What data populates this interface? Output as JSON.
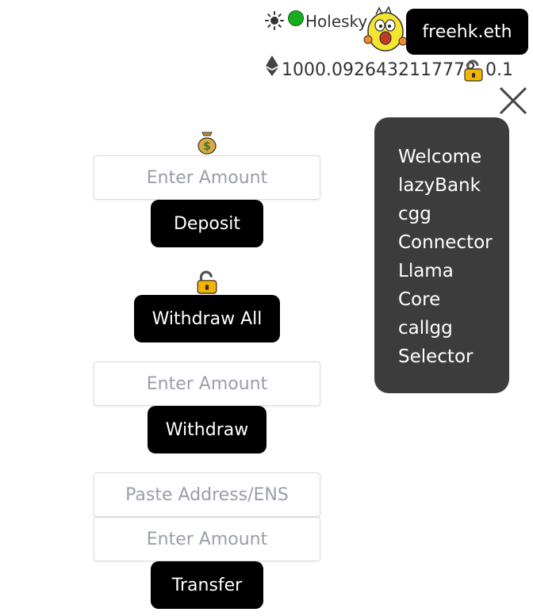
{
  "header": {
    "network_label": "Holesky",
    "account_label": "freehk.eth",
    "eth_balance": "1000.0926432117778",
    "locked_balance": "0.1"
  },
  "menu": {
    "items": [
      "Welcome",
      "lazyBank",
      "cgg",
      "Connector",
      "Llama",
      "Core",
      "callgg",
      "Selector"
    ]
  },
  "deposit": {
    "amount_placeholder": "Enter Amount",
    "button_label": "Deposit"
  },
  "withdraw_all": {
    "button_label": "Withdraw All"
  },
  "withdraw": {
    "amount_placeholder": "Enter Amount",
    "button_label": "Withdraw"
  },
  "transfer": {
    "address_placeholder": "Paste Address/ENS",
    "amount_placeholder": "Enter Amount",
    "button_label": "Transfer"
  },
  "colors": {
    "network_status": "#1aab1f",
    "button_bg": "#000000",
    "menu_bg": "#3c3c3c"
  }
}
